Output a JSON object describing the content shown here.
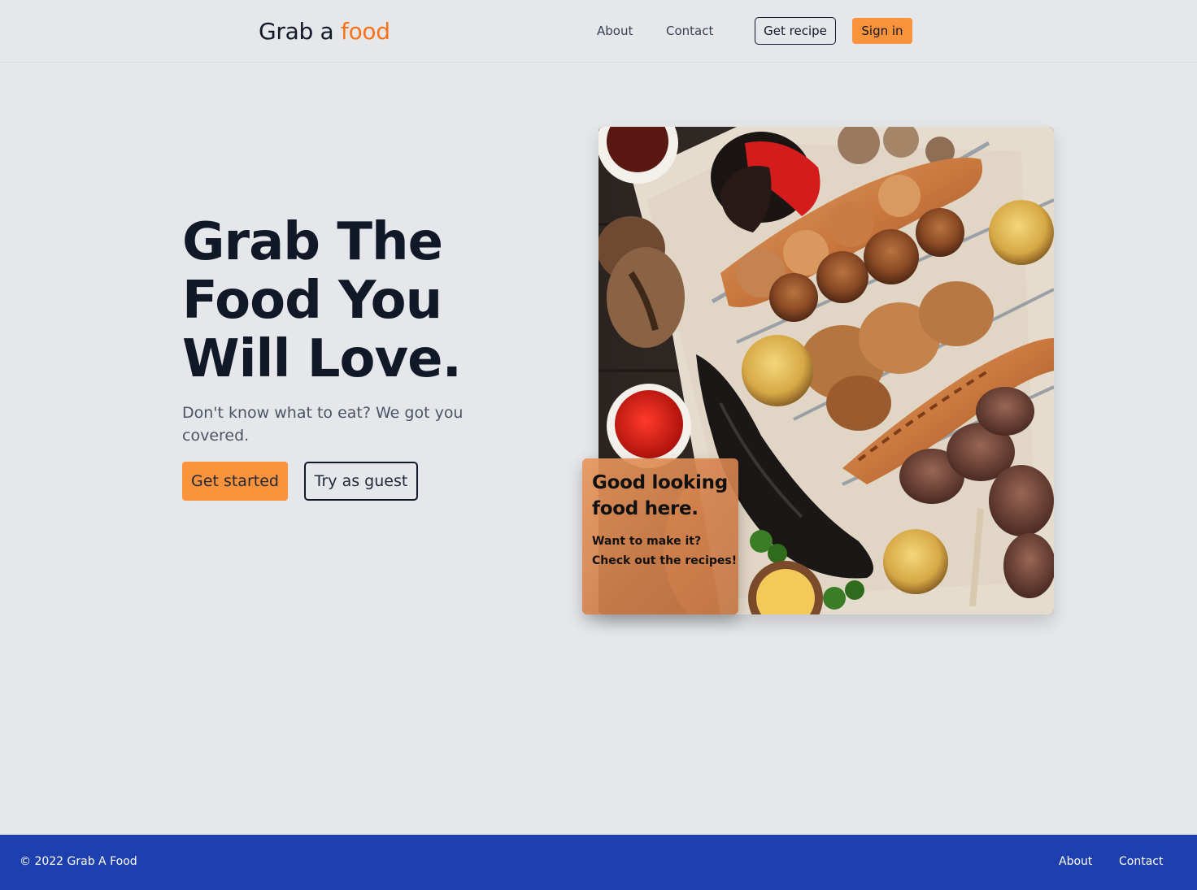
{
  "header": {
    "logo_prefix": "Grab a",
    "logo_accent": "food",
    "nav": {
      "about": "About",
      "contact": "Contact"
    },
    "get_recipe_label": "Get recipe",
    "sign_in_label": "Sign in"
  },
  "hero": {
    "title_line1": "Grab The",
    "title_line2": "Food You",
    "title_line3": "Will Love.",
    "subtitle": "Don't know what to eat? We got you covered.",
    "get_started_label": "Get started",
    "guest_label": "Try as guest"
  },
  "image": {
    "subject": "grilled-meat-platter"
  },
  "promo_card": {
    "title": "Good looking food here.",
    "line1": "Want to make it?",
    "line2": "Check out the recipes!"
  },
  "footer": {
    "copyright": "© 2022 Grab A Food",
    "about": "About",
    "contact": "Contact"
  },
  "colors": {
    "background": "#e5e7eb",
    "accent": "#f97316",
    "button_fill": "#fb923c",
    "footer_bg": "#1e40af",
    "text_dark": "#111827"
  }
}
